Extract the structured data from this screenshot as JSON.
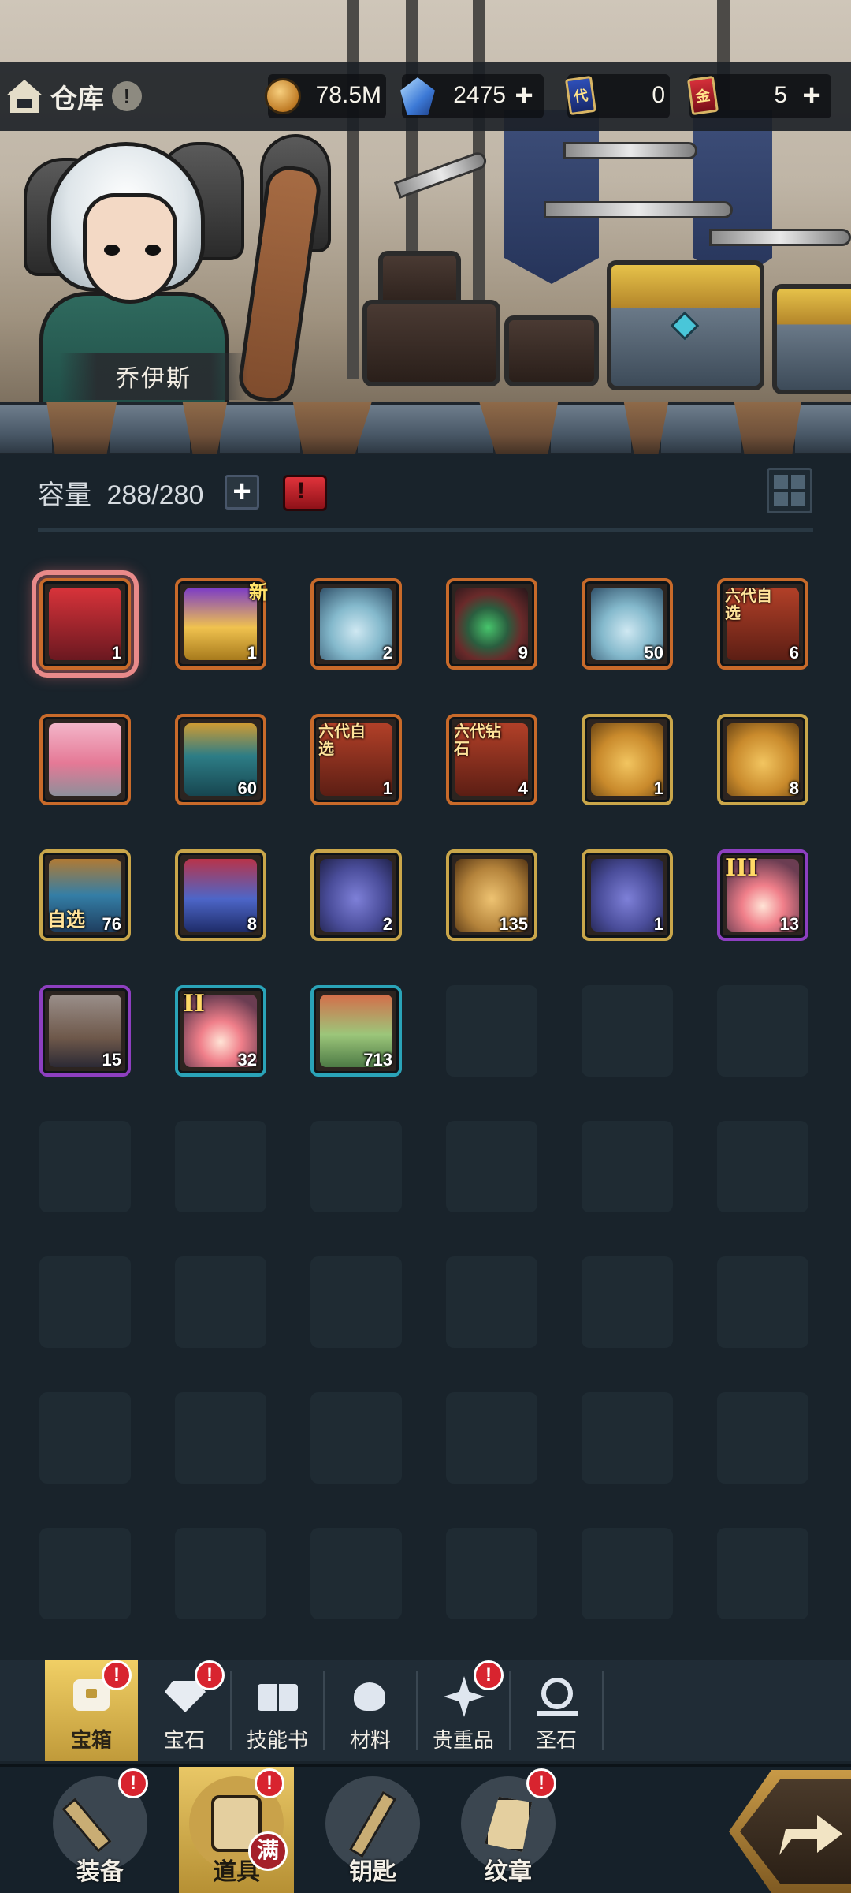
{
  "header": {
    "title": "仓库",
    "hero_name": "乔伊斯",
    "currencies": [
      {
        "name": "gold",
        "value": "78.5M"
      },
      {
        "name": "crystal",
        "value": "2475"
      },
      {
        "name": "card-blue",
        "icon_text": "代",
        "value": "0"
      },
      {
        "name": "card-red",
        "icon_text": "金",
        "value": "5"
      }
    ]
  },
  "inventory": {
    "capacity_label": "容量",
    "capacity_value": "288/280",
    "items": [
      {
        "id": "red-chest",
        "qty": "1",
        "selected": true
      },
      {
        "id": "gold-chest",
        "qty": "1",
        "new": "新"
      },
      {
        "id": "gem-sack",
        "qty": "2"
      },
      {
        "id": "rose-ring",
        "qty": "9"
      },
      {
        "id": "gem-sack-2",
        "qty": "50"
      },
      {
        "id": "six-gen-select",
        "qty": "6",
        "tag": "六代自选"
      },
      {
        "id": "pink-chest",
        "qty": ""
      },
      {
        "id": "teal-chest",
        "qty": "60"
      },
      {
        "id": "six-gen-select-2",
        "qty": "1",
        "tag": "六代自选"
      },
      {
        "id": "six-gen-gem",
        "qty": "4",
        "tag": "六代钻石"
      },
      {
        "id": "gold-bag",
        "qty": "1"
      },
      {
        "id": "gold-bag-2",
        "qty": "8"
      },
      {
        "id": "select-chest",
        "qty": "76",
        "tag": "自选"
      },
      {
        "id": "blue-chest",
        "qty": "8"
      },
      {
        "id": "blue-vase",
        "qty": "2"
      },
      {
        "id": "gold-vase",
        "qty": "135"
      },
      {
        "id": "blue-vase-2",
        "qty": "1"
      },
      {
        "id": "relic-3",
        "qty": "13",
        "roman": "III"
      },
      {
        "id": "mask",
        "qty": "15"
      },
      {
        "id": "relic-2",
        "qty": "32",
        "roman": "II"
      },
      {
        "id": "gift-box",
        "qty": "713"
      }
    ]
  },
  "subtabs": [
    {
      "label": "宝箱",
      "active": true,
      "badge": "!"
    },
    {
      "label": "宝石",
      "badge": "!"
    },
    {
      "label": "技能书"
    },
    {
      "label": "材料"
    },
    {
      "label": "贵重品",
      "badge": "!"
    },
    {
      "label": "圣石"
    }
  ],
  "bottom_nav": [
    {
      "label": "装备",
      "badge": "!"
    },
    {
      "label": "道具",
      "active": true,
      "badge": "!",
      "status": "满"
    },
    {
      "label": "钥匙"
    },
    {
      "label": "纹章",
      "badge": "!"
    }
  ],
  "colors": {
    "background": "#19232b",
    "active_tab": "#e9c766",
    "alert": "#d8242f",
    "border_orange": "#c86a2a",
    "border_gold": "#c9a64a",
    "border_purple": "#8d3fc0",
    "border_cyan": "#2aa3b8"
  }
}
